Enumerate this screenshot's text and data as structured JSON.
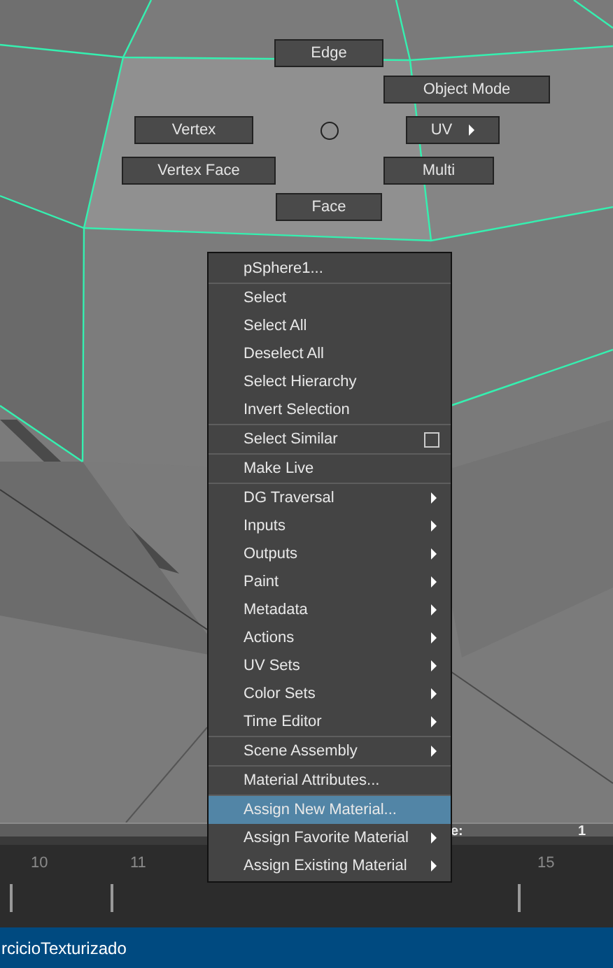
{
  "marking_menu": {
    "buttons": [
      {
        "label": "Edge",
        "submenu": false
      },
      {
        "label": "Object Mode",
        "submenu": false
      },
      {
        "label": "Vertex",
        "submenu": false
      },
      {
        "label": "UV",
        "submenu": true
      },
      {
        "label": "Vertex Face",
        "submenu": false
      },
      {
        "label": "Multi",
        "submenu": false
      },
      {
        "label": "Face",
        "submenu": false
      }
    ]
  },
  "channel_row": {
    "label": "e:",
    "value": "1"
  },
  "timeline": {
    "ticks": [
      "10",
      "11",
      "15"
    ]
  },
  "context_menu": {
    "sections": [
      [
        {
          "label": "pSphere1...",
          "kind": "item",
          "selected": false
        }
      ],
      [
        {
          "label": "Select",
          "kind": "item",
          "selected": false
        },
        {
          "label": "Select All",
          "kind": "item",
          "selected": false
        },
        {
          "label": "Deselect All",
          "kind": "item",
          "selected": false
        },
        {
          "label": "Select Hierarchy",
          "kind": "item",
          "selected": false
        },
        {
          "label": "Invert Selection",
          "kind": "item",
          "selected": false
        }
      ],
      [
        {
          "label": "Select Similar",
          "kind": "option",
          "selected": false
        }
      ],
      [
        {
          "label": "Make Live",
          "kind": "item",
          "selected": false
        }
      ],
      [
        {
          "label": "DG Traversal",
          "kind": "submenu",
          "selected": false
        },
        {
          "label": "Inputs",
          "kind": "submenu",
          "selected": false
        },
        {
          "label": "Outputs",
          "kind": "submenu",
          "selected": false
        },
        {
          "label": "Paint",
          "kind": "submenu",
          "selected": false
        },
        {
          "label": "Metadata",
          "kind": "submenu",
          "selected": false
        },
        {
          "label": "Actions",
          "kind": "submenu",
          "selected": false
        },
        {
          "label": "UV Sets",
          "kind": "submenu",
          "selected": false
        },
        {
          "label": "Color Sets",
          "kind": "submenu",
          "selected": false
        },
        {
          "label": "Time Editor",
          "kind": "submenu",
          "selected": false
        }
      ],
      [
        {
          "label": "Scene Assembly",
          "kind": "submenu",
          "selected": false
        }
      ],
      [
        {
          "label": "Material Attributes...",
          "kind": "item",
          "selected": false
        }
      ],
      [
        {
          "label": "Assign New Material...",
          "kind": "item",
          "selected": true
        },
        {
          "label": "Assign Favorite Material",
          "kind": "submenu",
          "selected": false
        },
        {
          "label": "Assign Existing Material",
          "kind": "submenu",
          "selected": false
        }
      ]
    ]
  },
  "status_bar": {
    "text": "rcicioTexturizado"
  }
}
